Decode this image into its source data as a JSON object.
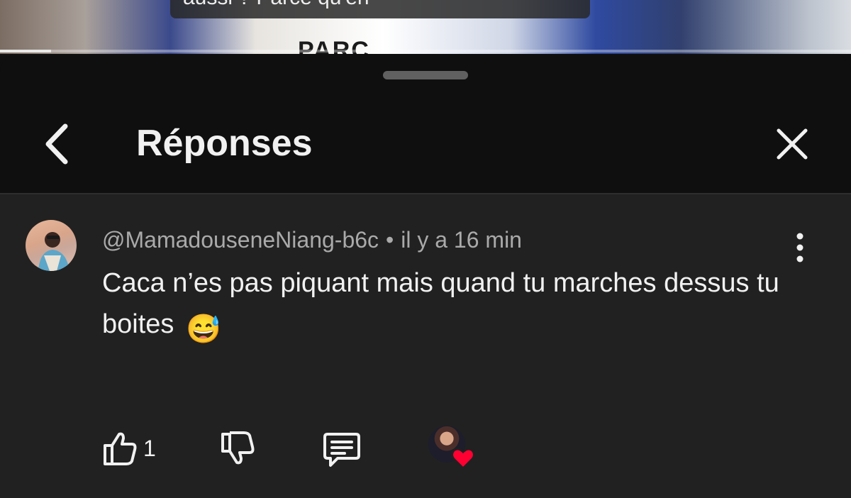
{
  "video": {
    "caption_partial": "aussi ? Parce qu'en",
    "shirt_text_partial": "PARC",
    "progress": 0.06
  },
  "sheet": {
    "title": "Réponses",
    "back_icon": "chevron-left-icon",
    "close_icon": "close-icon"
  },
  "comment": {
    "author": "@MamadouseneNiang-b6c",
    "separator": "•",
    "time": "il y a 16 min",
    "text": "Caca n’es pas piquant mais quand tu marches dessus tu boites",
    "emoji": "😅",
    "like_count": "1",
    "icons": [
      "thumb-up-icon",
      "thumb-down-icon",
      "reply-icon",
      "more-vertical-icon",
      "heart-icon"
    ]
  },
  "colors": {
    "background": "#0f0f0f",
    "comment_background": "#212121",
    "text_primary": "#f1f1f1",
    "text_secondary": "#aaaaaa",
    "heart": "#ff0033"
  }
}
